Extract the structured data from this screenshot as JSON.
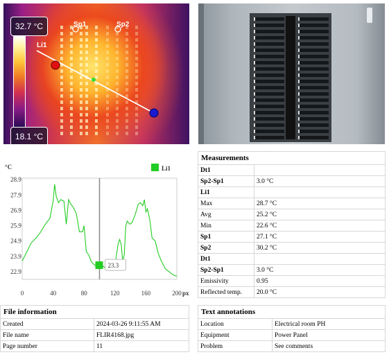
{
  "thermal": {
    "max_temp": "32.7",
    "min_temp": "18.1",
    "unit": "°C",
    "labels": {
      "sp1": "Sp1",
      "sp2": "Sp2",
      "li1": "Li1"
    }
  },
  "chart_data": {
    "type": "line",
    "ylabel": "°C",
    "xunit": "px",
    "legend": "Li1",
    "legend_placement": "top-right",
    "xlim": [
      0,
      200
    ],
    "ylim": [
      22.4,
      29.0
    ],
    "yticks": [
      "28.9",
      "27.9",
      "26.9",
      "25.9",
      "24.9",
      "23.9",
      "22.9"
    ],
    "xticks": [
      "0",
      "40",
      "80",
      "120",
      "160",
      "200"
    ],
    "grid": false,
    "marker": {
      "x": 100,
      "label": "23.3"
    },
    "series": [
      {
        "name": "Li1",
        "color": "#22cc22",
        "x": [
          0,
          6,
          12,
          18,
          24,
          30,
          36,
          40,
          42,
          44,
          47,
          50,
          54,
          57,
          60,
          63,
          66,
          70,
          74,
          78,
          80,
          83,
          86,
          89,
          92,
          95,
          98,
          101,
          104,
          108,
          112,
          116,
          120,
          124,
          126,
          128,
          130,
          132,
          134,
          136,
          139,
          142,
          146,
          150,
          153,
          156,
          158,
          160,
          162,
          165,
          168,
          172,
          176,
          180,
          185,
          190,
          195,
          200
        ],
        "y": [
          23.6,
          24.2,
          24.8,
          25.1,
          25.5,
          26.0,
          26.4,
          27.5,
          28.6,
          27.8,
          27.4,
          27.6,
          27.5,
          26.0,
          27.6,
          27.3,
          27.1,
          26.7,
          25.5,
          25.5,
          25.9,
          24.2,
          24.0,
          23.6,
          23.4,
          23.3,
          23.3,
          23.2,
          23.3,
          23.1,
          23.0,
          23.0,
          23.3,
          24.7,
          25.0,
          24.7,
          23.6,
          24.0,
          25.9,
          26.2,
          26.0,
          26.1,
          26.6,
          27.3,
          27.4,
          27.2,
          27.6,
          26.8,
          27.0,
          26.3,
          25.1,
          24.9,
          24.1,
          23.6,
          23.1,
          22.9,
          22.7,
          22.6
        ]
      }
    ]
  },
  "measurements": {
    "title": "Measurements",
    "rows": [
      {
        "label": "Dt1",
        "value": "",
        "bold": true
      },
      {
        "label": "Sp2-Sp1",
        "value": "3.0 °C",
        "bold": true
      },
      {
        "label": "Li1",
        "value": "",
        "bold": true
      },
      {
        "label": "Max",
        "value": "28.7 °C",
        "bold": false
      },
      {
        "label": "Avg",
        "value": "25.2 °C",
        "bold": false
      },
      {
        "label": "Min",
        "value": "22.6 °C",
        "bold": false
      },
      {
        "label": "Sp1",
        "value": "27.1 °C",
        "bold": true
      },
      {
        "label": "Sp2",
        "value": "30.2 °C",
        "bold": true
      },
      {
        "label": "Dt1",
        "value": "",
        "bold": true
      },
      {
        "label": "Sp2-Sp1",
        "value": "3.0 °C",
        "bold": true
      },
      {
        "label": "Emissivity",
        "value": "0.95",
        "bold": false
      },
      {
        "label": "Reflected temp.",
        "value": "20.0 °C",
        "bold": false
      }
    ]
  },
  "file_info": {
    "title": "File information",
    "rows": [
      {
        "label": "Created",
        "value": "2024-03-26 9:11:55 AM"
      },
      {
        "label": "File name",
        "value": "FLIR4168.jpg"
      },
      {
        "label": "Page number",
        "value": "11"
      }
    ]
  },
  "text_annotations": {
    "title": "Text annotations",
    "rows": [
      {
        "label": "Location",
        "value": "Electrical room PH"
      },
      {
        "label": "Equipment",
        "value": "Power Panel"
      },
      {
        "label": "Problem",
        "value": "See comments"
      }
    ]
  }
}
